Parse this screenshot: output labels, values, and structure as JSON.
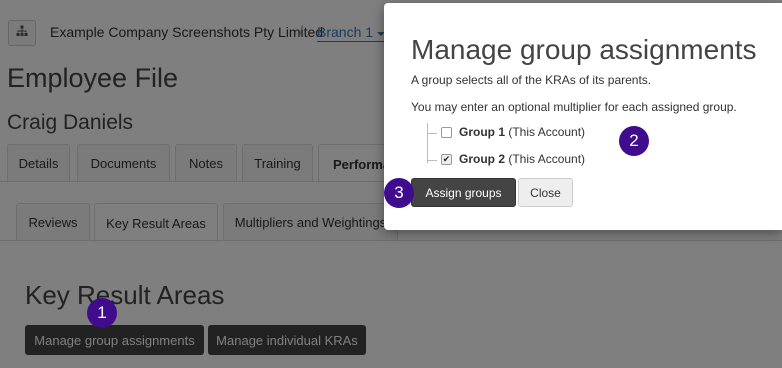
{
  "header": {
    "company": "Example Company Screenshots Pty Limited",
    "separator": "/",
    "branch": "Branch 1",
    "org_icon": "org-chart-icon",
    "branch_caret_icon": "caret-down-icon"
  },
  "page": {
    "title": "Employee File",
    "person": "Craig Daniels"
  },
  "main_tabs": [
    "Details",
    "Documents",
    "Notes",
    "Training",
    "Performa"
  ],
  "sub_tabs": [
    "Reviews",
    "Key Result Areas",
    "Multipliers and Weightings"
  ],
  "section": {
    "title": "Key Result Areas",
    "manage_group_btn": "Manage group assignments",
    "manage_individual_btn": "Manage individual KRAs"
  },
  "modal": {
    "title": "Manage group assignments",
    "line1": "A group selects all of the KRAs of its parents.",
    "line2": "You may enter an optional multiplier for each assigned group.",
    "groups": [
      {
        "name": "Group 1",
        "account": "(This Account)",
        "checked": false
      },
      {
        "name": "Group 2",
        "account": "(This Account)",
        "checked": true
      }
    ],
    "assign_btn": "Assign groups",
    "close_btn": "Close"
  },
  "callouts": [
    "1",
    "2",
    "3"
  ],
  "colors": {
    "callout": "#3f0c8d",
    "dark_button": "#444444",
    "link": "#337ab7"
  }
}
